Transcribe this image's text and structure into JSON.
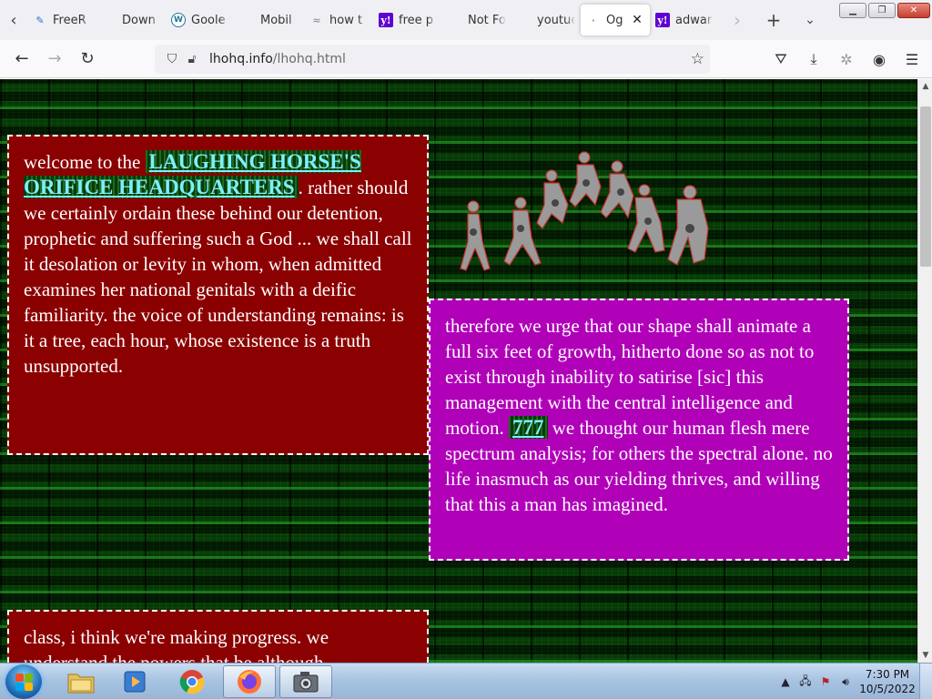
{
  "browser": {
    "tabs": [
      {
        "label": "FreeR",
        "icon": "page-icon",
        "active": false
      },
      {
        "label": "Down",
        "icon": "none",
        "active": false
      },
      {
        "label": "Goole",
        "icon": "wordpress-icon",
        "active": false
      },
      {
        "label": "Mobil",
        "icon": "none",
        "active": false
      },
      {
        "label": "how t",
        "icon": "page-icon",
        "active": false
      },
      {
        "label": "free p",
        "icon": "yahoo-icon",
        "active": false
      },
      {
        "label": "Not Found",
        "icon": "none",
        "active": false
      },
      {
        "label": "youtue.co",
        "icon": "none",
        "active": false
      },
      {
        "label": "Og",
        "icon": "loading-icon",
        "active": true
      },
      {
        "label": "adwar",
        "icon": "yahoo-icon",
        "active": false
      }
    ],
    "url": {
      "host": "lhohq.info",
      "path": "/lhohq.html"
    }
  },
  "page": {
    "box1": {
      "intro": "welcome to the ",
      "link": "LAUGHING HORSE'S ORIFICE HEADQUARTERS",
      "body": ". rather should we certainly ordain these behind our detention, prophetic and suffering such a God ... we shall call it desolation or levity in whom, when admitted examines her national genitals with a deific familiarity. the voice of understanding remains: is it a tree, each hour, whose existence is a truth unsupported."
    },
    "box2": {
      "before": "therefore we urge that our shape shall animate a full six feet of growth, hitherto done so as not to exist through inability to satirise [sic] this management with the central intelligence and motion. ",
      "link": "777",
      "after": " we thought our human flesh mere spectrum analysis; for others the spectral alone. no life inasmuch as our yielding thrives, and willing that this a man has imagined."
    },
    "box3": {
      "line1": "class, i think we're making progress. we",
      "line2": "understand the powers that be although"
    },
    "colors": {
      "box_red": "#8b0000",
      "box_magenta": "#b000b8",
      "link_text": "#7cf0ff",
      "background": "#031603"
    }
  },
  "taskbar": {
    "apps": [
      "explorer",
      "media-player",
      "chrome",
      "firefox",
      "camera"
    ],
    "time": "7:30 PM",
    "date": "10/5/2022"
  }
}
